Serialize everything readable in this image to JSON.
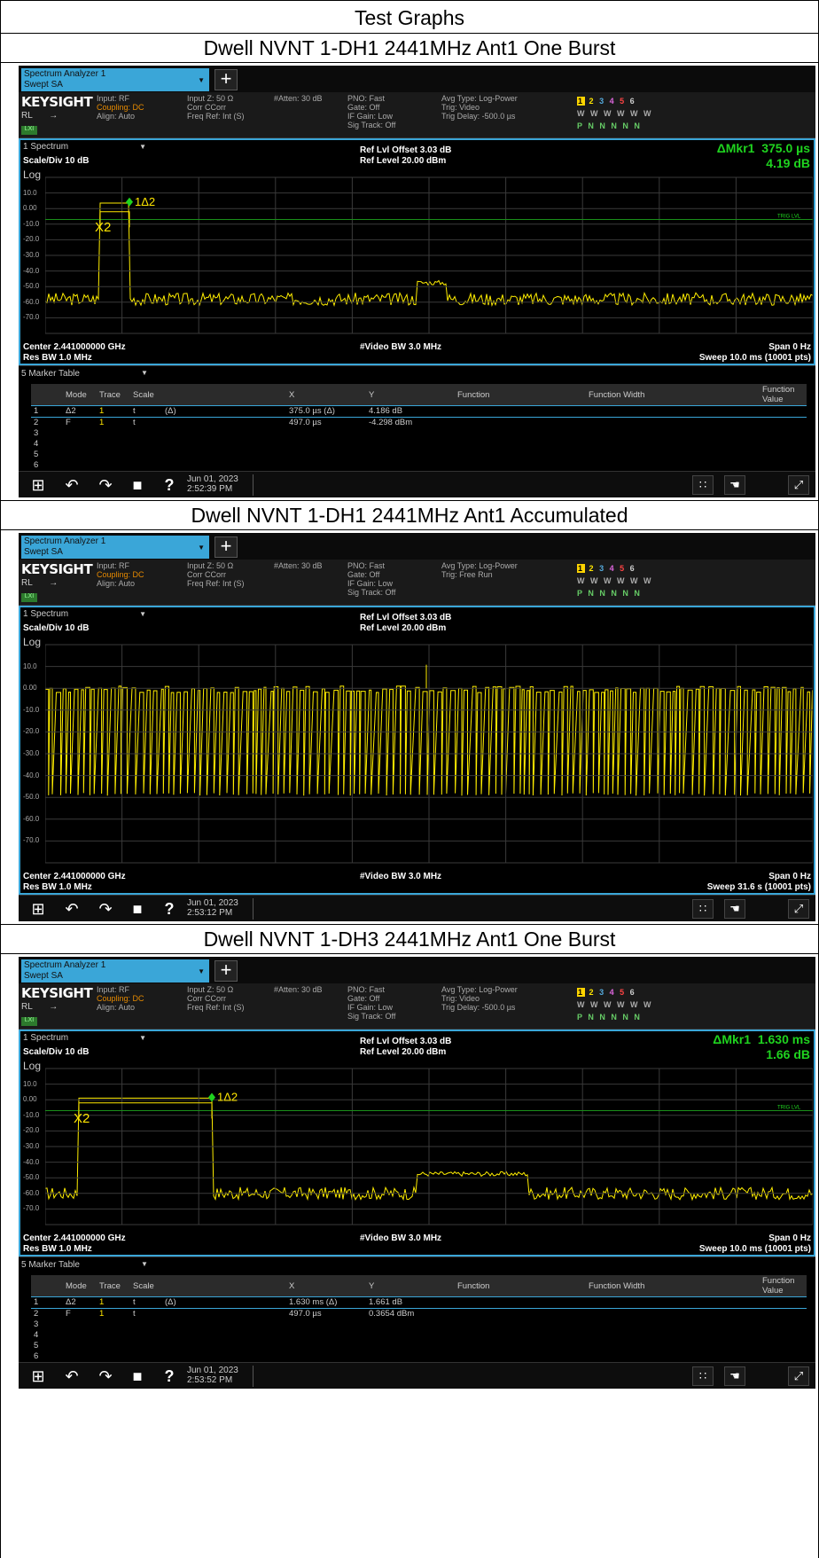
{
  "page_title": "Test Graphs",
  "sections": [
    {
      "title": "Dwell NVNT 1-DH1 2441MHz Ant1 One Burst",
      "mkr_label": "ΔMkr1",
      "mkr_x": "375.0 µs",
      "mkr_y": "4.19 dB",
      "trig": "Trig: Video",
      "trig_delay": "Trig Delay: -500.0 µs",
      "pno": "PNO: Fast",
      "sweep": "Sweep 10.0 ms (10001 pts)",
      "date": "Jun 01, 2023",
      "time": "2:52:39 PM",
      "markers": [
        {
          "n": "1",
          "mode": "Δ2",
          "trace": "1",
          "scale": "t",
          "fn": "(Δ)",
          "x": "375.0 µs (Δ)",
          "y": "4.186 dB"
        },
        {
          "n": "2",
          "mode": "F",
          "trace": "1",
          "scale": "t",
          "fn": "",
          "x": "497.0 µs",
          "y": "-4.298 dBm"
        },
        {
          "n": "3",
          "mode": "",
          "trace": "",
          "scale": "",
          "fn": "",
          "x": "",
          "y": ""
        },
        {
          "n": "4",
          "mode": "",
          "trace": "",
          "scale": "",
          "fn": "",
          "x": "",
          "y": ""
        },
        {
          "n": "5",
          "mode": "",
          "trace": "",
          "scale": "",
          "fn": "",
          "x": "",
          "y": ""
        },
        {
          "n": "6",
          "mode": "",
          "trace": "",
          "scale": "",
          "fn": "",
          "x": "",
          "y": ""
        }
      ]
    },
    {
      "title": "Dwell NVNT 1-DH1 2441MHz Ant1 Accumulated",
      "trig": "Trig: Free Run",
      "trig_delay": "",
      "pno": "PNO: Fast",
      "sweep": "Sweep 31.6 s (10001 pts)",
      "date": "Jun 01, 2023",
      "time": "2:53:12 PM"
    },
    {
      "title": "Dwell NVNT 1-DH3 2441MHz Ant1 One Burst",
      "mkr_label": "ΔMkr1",
      "mkr_x": "1.630 ms",
      "mkr_y": "1.66 dB",
      "trig": "Trig: Video",
      "trig_delay": "Trig Delay: -500.0 µs",
      "pno": "PNO: Fast",
      "sweep": "Sweep 10.0 ms (10001 pts)",
      "date": "Jun 01, 2023",
      "time": "2:53:52 PM",
      "markers": [
        {
          "n": "1",
          "mode": "Δ2",
          "trace": "1",
          "scale": "t",
          "fn": "(Δ)",
          "x": "1.630 ms (Δ)",
          "y": "1.661 dB"
        },
        {
          "n": "2",
          "mode": "F",
          "trace": "1",
          "scale": "t",
          "fn": "",
          "x": "497.0 µs",
          "y": "0.3654 dBm"
        },
        {
          "n": "3",
          "mode": "",
          "trace": "",
          "scale": "",
          "fn": "",
          "x": "",
          "y": ""
        },
        {
          "n": "4",
          "mode": "",
          "trace": "",
          "scale": "",
          "fn": "",
          "x": "",
          "y": ""
        },
        {
          "n": "5",
          "mode": "",
          "trace": "",
          "scale": "",
          "fn": "",
          "x": "",
          "y": ""
        },
        {
          "n": "6",
          "mode": "",
          "trace": "",
          "scale": "",
          "fn": "",
          "x": "",
          "y": ""
        }
      ]
    }
  ],
  "common": {
    "mode_line1": "Spectrum Analyzer 1",
    "mode_line2": "Swept SA",
    "brand": "KEYSIGHT",
    "input": "Input: RF",
    "coupling": "Coupling: DC",
    "align": "Align: Auto",
    "input_z": "Input Z: 50 Ω",
    "corr": "Corr CCorr",
    "freq_ref": "Freq Ref: Int (S)",
    "atten": "#Atten: 30 dB",
    "gate": "Gate: Off",
    "if_gain": "IF Gain: Low",
    "sig_track": "Sig Track: Off",
    "avg_type": "Avg Type: Log-Power",
    "trace_nums": "1 2 3 4 5 6",
    "trace_w": "W W W W W W",
    "trace_p": "P N N N N N",
    "rl": "RL",
    "lxi": "LXI",
    "panel": "1 Spectrum",
    "scale_div": "Scale/Div 10 dB",
    "log": "Log",
    "ref_offset": "Ref Lvl Offset 3.03 dB",
    "ref_level": "Ref Level 20.00 dBm",
    "center": "Center 2.441000000 GHz",
    "res_bw": "Res BW 1.0 MHz",
    "video_bw": "#Video BW 3.0 MHz",
    "span": "Span 0 Hz",
    "marker_table": "5 Marker Table",
    "trig_lvl": "TRIG LVL",
    "y_ticks": [
      "10.0",
      "0.00",
      "-10.0",
      "-20.0",
      "-30.0",
      "-40.0",
      "-50.0",
      "-60.0",
      "-70.0"
    ],
    "col_headers": [
      "Mode",
      "Trace",
      "Scale",
      "X",
      "Y",
      "Function",
      "Function Width",
      "Function Value"
    ],
    "mkr1": "1Δ2",
    "mkr2": "X2"
  },
  "colors": {
    "trace": "#ffee00",
    "marker": "#1fd31f",
    "accent": "#3aa6d8"
  }
}
